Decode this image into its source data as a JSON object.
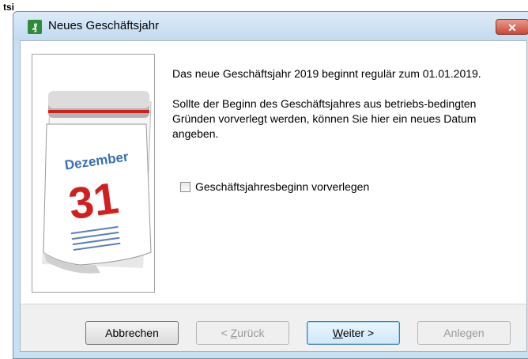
{
  "background": {
    "partial_text": "tsi"
  },
  "window": {
    "title": "Neues Geschäftsjahr",
    "close_glyph": "✕",
    "app_icon": "accounting-app-icon"
  },
  "calendar": {
    "month": "Dezember",
    "day": "31"
  },
  "content": {
    "paragraph1": "Das neue Geschäftsjahr 2019 beginnt regulär zum 01.01.2019.",
    "paragraph2": "Sollte der Beginn des Geschäftsjahres aus betriebs-bedingten Gründen vorverlegt werden, können Sie hier ein neues Datum angeben."
  },
  "checkbox": {
    "label": "Geschäftsjahresbeginn vorverlegen",
    "checked": false
  },
  "buttons": {
    "cancel": "Abbrechen",
    "back_prefix": "< ",
    "back_mnemonic": "Z",
    "back_rest": "urück",
    "next_mnemonic": "W",
    "next_rest": "eiter >",
    "finish": "Anlegen"
  },
  "colors": {
    "close_button": "#c8493a",
    "calendar_red": "#d11f1f",
    "calendar_blue": "#3a6fb5"
  }
}
